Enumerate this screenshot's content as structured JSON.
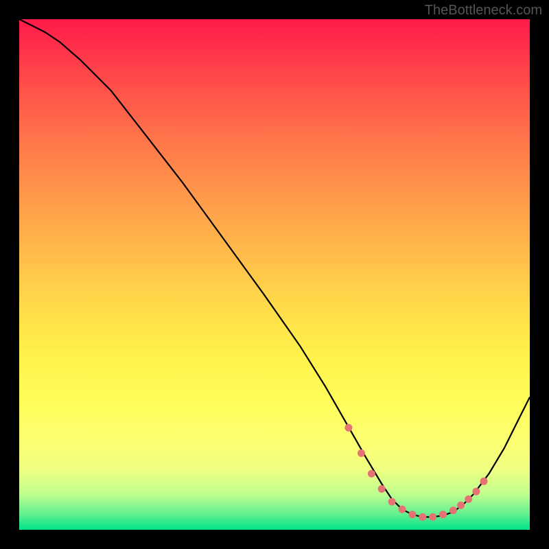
{
  "watermark": "TheBottleneck.com",
  "chart_data": {
    "type": "line",
    "title": "",
    "xlabel": "",
    "ylabel": "",
    "xlim": [
      0,
      100
    ],
    "ylim": [
      0,
      100
    ],
    "series": [
      {
        "name": "curve",
        "x": [
          0,
          2,
          5,
          8,
          12,
          18,
          25,
          32,
          40,
          48,
          55,
          60,
          64,
          68,
          71,
          73,
          75,
          77,
          79,
          81,
          83,
          85,
          87,
          89,
          92,
          95,
          98,
          100
        ],
        "y": [
          100,
          99,
          97.5,
          95.5,
          92,
          86,
          77,
          68,
          57,
          46,
          36,
          28,
          21,
          14,
          9,
          6,
          4,
          3,
          2.5,
          2.5,
          2.8,
          3.5,
          5,
          7,
          11,
          16,
          22,
          26
        ]
      }
    ],
    "markers": {
      "name": "highlight-dots",
      "x": [
        64.5,
        67,
        69,
        71,
        73,
        75,
        77,
        79,
        81,
        83,
        85,
        86.5,
        88,
        89.5,
        91
      ],
      "y": [
        20,
        15,
        11,
        8,
        5.5,
        4,
        3,
        2.5,
        2.5,
        3,
        3.8,
        4.8,
        6,
        7.5,
        9.5
      ]
    },
    "background_gradient": {
      "top": "#ff1a4a",
      "bottom": "#00e088"
    }
  }
}
